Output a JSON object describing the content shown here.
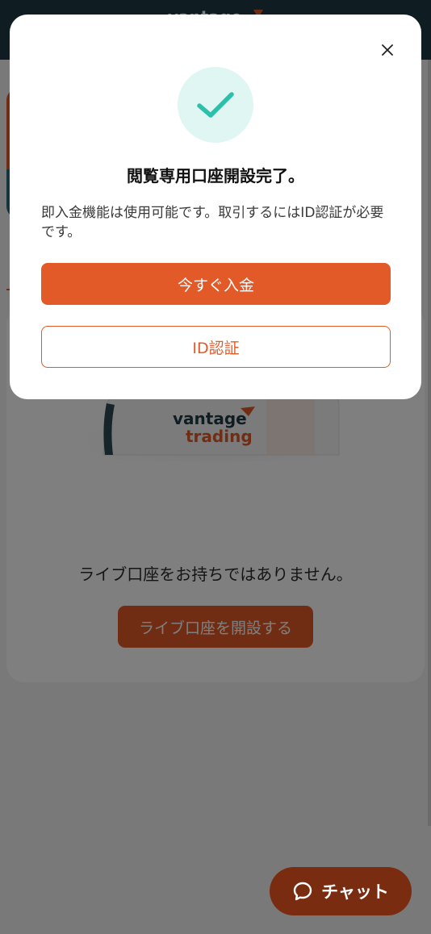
{
  "header": {
    "logo_text": "vantage"
  },
  "promo": {
    "logo_line1": "vantage",
    "logo_line2": "trading"
  },
  "empty_state": {
    "message": "ライブ口座をお持ちではありません。",
    "open_live_button": "ライブ口座を開設する"
  },
  "chat": {
    "label": "チャット",
    "icon": "chat-bubble-icon"
  },
  "modal": {
    "close_icon": "close-icon",
    "success_icon": "check-icon",
    "title": "閲覧専用口座開設完了。",
    "description": "即入金機能は使用可能です。取引するにはID認証が必要です。",
    "deposit_button": "今すぐ入金",
    "verify_button": "ID認証"
  },
  "colors": {
    "brand_orange": "#e25a27",
    "header_navy": "#1f3a46",
    "success_teal": "#2dbfab",
    "success_bg": "#dff6f3"
  }
}
